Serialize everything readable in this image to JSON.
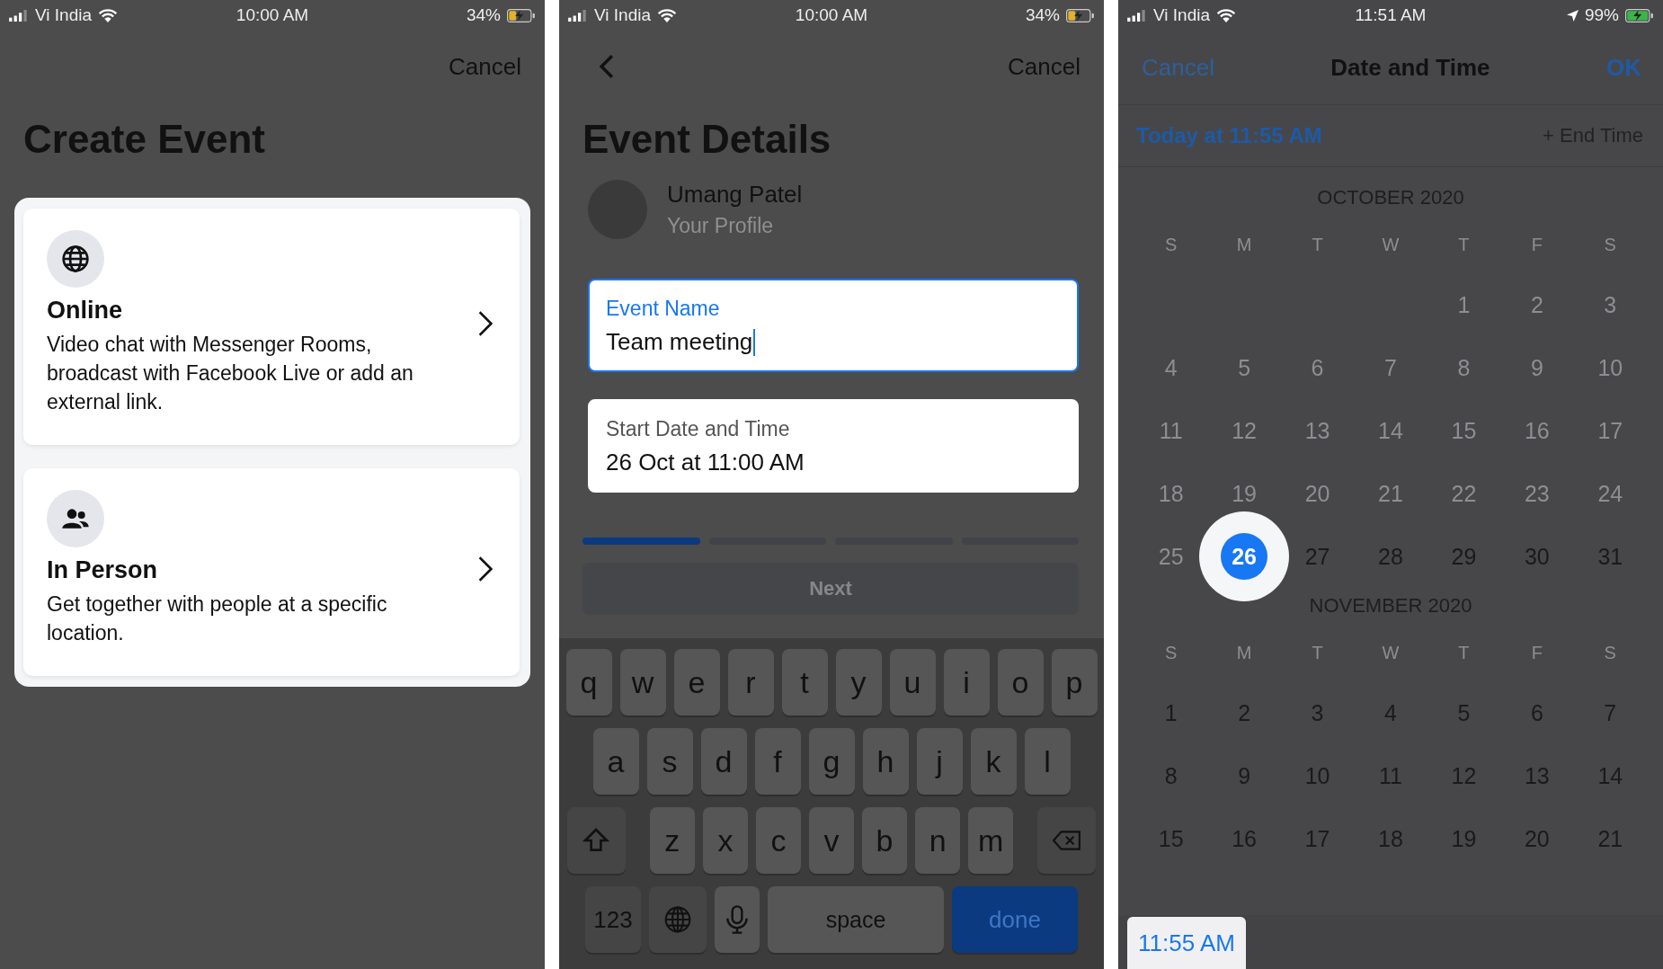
{
  "screens": [
    {
      "kind": "create",
      "status": {
        "carrier": "Vi India",
        "time": "10:00 AM",
        "battery": "34%"
      },
      "cancel": "Cancel",
      "title": "Create Event",
      "options": [
        {
          "kind": "online",
          "title": "Online",
          "description": "Video chat with Messenger Rooms, broadcast with Facebook Live or add an external link."
        },
        {
          "kind": "person",
          "title": "In Person",
          "description": "Get together with people at a specific location."
        }
      ]
    },
    {
      "kind": "details",
      "status": {
        "carrier": "Vi India",
        "time": "10:00 AM",
        "battery": "34%"
      },
      "cancel": "Cancel",
      "title": "Event Details",
      "profile": {
        "name": "Umang Patel",
        "subtitle": "Your Profile"
      },
      "fields": [
        {
          "label": "Event Name",
          "value": "Team meeting",
          "focused": true
        },
        {
          "label": "Start Date and Time",
          "value": "26 Oct at 11:00 AM",
          "focused": false
        }
      ],
      "steps": [
        {
          "completed": true
        },
        {
          "completed": false
        },
        {
          "completed": false
        },
        {
          "completed": false
        }
      ],
      "next": {
        "label": "Next",
        "disabled": true
      },
      "keyboard": [
        [
          {
            "kind": "letter",
            "label": "q"
          },
          {
            "kind": "letter",
            "label": "w"
          },
          {
            "kind": "letter",
            "label": "e"
          },
          {
            "kind": "letter",
            "label": "r"
          },
          {
            "kind": "letter",
            "label": "t"
          },
          {
            "kind": "letter",
            "label": "y"
          },
          {
            "kind": "letter",
            "label": "u"
          },
          {
            "kind": "letter",
            "label": "i"
          },
          {
            "kind": "letter",
            "label": "o"
          },
          {
            "kind": "letter",
            "label": "p"
          }
        ],
        [
          {
            "kind": "letter",
            "label": "a"
          },
          {
            "kind": "letter",
            "label": "s"
          },
          {
            "kind": "letter",
            "label": "d"
          },
          {
            "kind": "letter",
            "label": "f"
          },
          {
            "kind": "letter",
            "label": "g"
          },
          {
            "kind": "letter",
            "label": "h"
          },
          {
            "kind": "letter",
            "label": "j"
          },
          {
            "kind": "letter",
            "label": "k"
          },
          {
            "kind": "letter",
            "label": "l"
          }
        ],
        [
          {
            "kind": "shift"
          },
          {
            "kind": "letter",
            "label": "z"
          },
          {
            "kind": "letter",
            "label": "x"
          },
          {
            "kind": "letter",
            "label": "c"
          },
          {
            "kind": "letter",
            "label": "v"
          },
          {
            "kind": "letter",
            "label": "b"
          },
          {
            "kind": "letter",
            "label": "n"
          },
          {
            "kind": "letter",
            "label": "m"
          },
          {
            "kind": "delete"
          }
        ],
        [
          {
            "kind": "numbers",
            "label": "123"
          },
          {
            "kind": "globe"
          },
          {
            "kind": "mic"
          },
          {
            "kind": "space",
            "label": "space"
          },
          {
            "kind": "done",
            "label": "done"
          }
        ]
      ]
    },
    {
      "kind": "date",
      "status": {
        "carrier": "Vi India",
        "time": "11:51 AM",
        "battery": "99%",
        "location": true
      },
      "cancel": "Cancel",
      "title": "Date and Time",
      "ok": "OK",
      "start": "Today at 11:55 AM",
      "end": "+ End Time",
      "months": [
        {
          "name": "OCTOBER 2020",
          "weekdays": [
            "S",
            "M",
            "T",
            "W",
            "T",
            "F",
            "S"
          ],
          "weeks": [
            {
              "right_aligned": true,
              "days": [
                {
                  "label": "1",
                  "past": true,
                  "selected": false
                },
                {
                  "label": "2",
                  "past": true,
                  "selected": false
                },
                {
                  "label": "3",
                  "past": true,
                  "selected": false
                }
              ]
            },
            {
              "days": [
                {
                  "label": "4",
                  "past": true,
                  "selected": false
                },
                {
                  "label": "5",
                  "past": true,
                  "selected": false
                },
                {
                  "label": "6",
                  "past": true,
                  "selected": false
                },
                {
                  "label": "7",
                  "past": true,
                  "selected": false
                },
                {
                  "label": "8",
                  "past": true,
                  "selected": false
                },
                {
                  "label": "9",
                  "past": true,
                  "selected": false
                },
                {
                  "label": "10",
                  "past": true,
                  "selected": false
                }
              ]
            },
            {
              "days": [
                {
                  "label": "11",
                  "past": true,
                  "selected": false
                },
                {
                  "label": "12",
                  "past": true,
                  "selected": false
                },
                {
                  "label": "13",
                  "past": true,
                  "selected": false
                },
                {
                  "label": "14",
                  "past": true,
                  "selected": false
                },
                {
                  "label": "15",
                  "past": true,
                  "selected": false
                },
                {
                  "label": "16",
                  "past": true,
                  "selected": false
                },
                {
                  "label": "17",
                  "past": true,
                  "selected": false
                }
              ]
            },
            {
              "days": [
                {
                  "label": "18",
                  "past": true,
                  "selected": false
                },
                {
                  "label": "19",
                  "past": true,
                  "selected": false
                },
                {
                  "label": "20",
                  "past": true,
                  "selected": false
                },
                {
                  "label": "21",
                  "past": true,
                  "selected": false
                },
                {
                  "label": "22",
                  "past": true,
                  "selected": false
                },
                {
                  "label": "23",
                  "past": true,
                  "selected": false
                },
                {
                  "label": "24",
                  "past": true,
                  "selected": false
                }
              ]
            },
            {
              "days": [
                {
                  "label": "25",
                  "past": true,
                  "selected": false
                },
                {
                  "label": "26",
                  "past": false,
                  "selected": true
                },
                {
                  "label": "27",
                  "past": false,
                  "selected": false
                },
                {
                  "label": "28",
                  "past": false,
                  "selected": false
                },
                {
                  "label": "29",
                  "past": false,
                  "selected": false
                },
                {
                  "label": "30",
                  "past": false,
                  "selected": false
                },
                {
                  "label": "31",
                  "past": false,
                  "selected": false
                }
              ]
            }
          ]
        },
        {
          "name": "NOVEMBER 2020",
          "weekdays": [
            "S",
            "M",
            "T",
            "W",
            "T",
            "F",
            "S"
          ],
          "weeks": [
            {
              "days": [
                {
                  "label": "1",
                  "past": false,
                  "selected": false
                },
                {
                  "label": "2",
                  "past": false,
                  "selected": false
                },
                {
                  "label": "3",
                  "past": false,
                  "selected": false
                },
                {
                  "label": "4",
                  "past": false,
                  "selected": false
                },
                {
                  "label": "5",
                  "past": false,
                  "selected": false
                },
                {
                  "label": "6",
                  "past": false,
                  "selected": false
                },
                {
                  "label": "7",
                  "past": false,
                  "selected": false
                }
              ]
            },
            {
              "days": [
                {
                  "label": "8",
                  "past": false,
                  "selected": false
                },
                {
                  "label": "9",
                  "past": false,
                  "selected": false
                },
                {
                  "label": "10",
                  "past": false,
                  "selected": false
                },
                {
                  "label": "11",
                  "past": false,
                  "selected": false
                },
                {
                  "label": "12",
                  "past": false,
                  "selected": false
                },
                {
                  "label": "13",
                  "past": false,
                  "selected": false
                },
                {
                  "label": "14",
                  "past": false,
                  "selected": false
                }
              ]
            },
            {
              "days": [
                {
                  "label": "15",
                  "past": false,
                  "selected": false
                },
                {
                  "label": "16",
                  "past": false,
                  "selected": false
                },
                {
                  "label": "17",
                  "past": false,
                  "selected": false
                },
                {
                  "label": "18",
                  "past": false,
                  "selected": false
                },
                {
                  "label": "19",
                  "past": false,
                  "selected": false
                },
                {
                  "label": "20",
                  "past": false,
                  "selected": false
                },
                {
                  "label": "21",
                  "past": false,
                  "selected": false
                }
              ]
            }
          ]
        }
      ],
      "time": "11:55 AM"
    }
  ]
}
